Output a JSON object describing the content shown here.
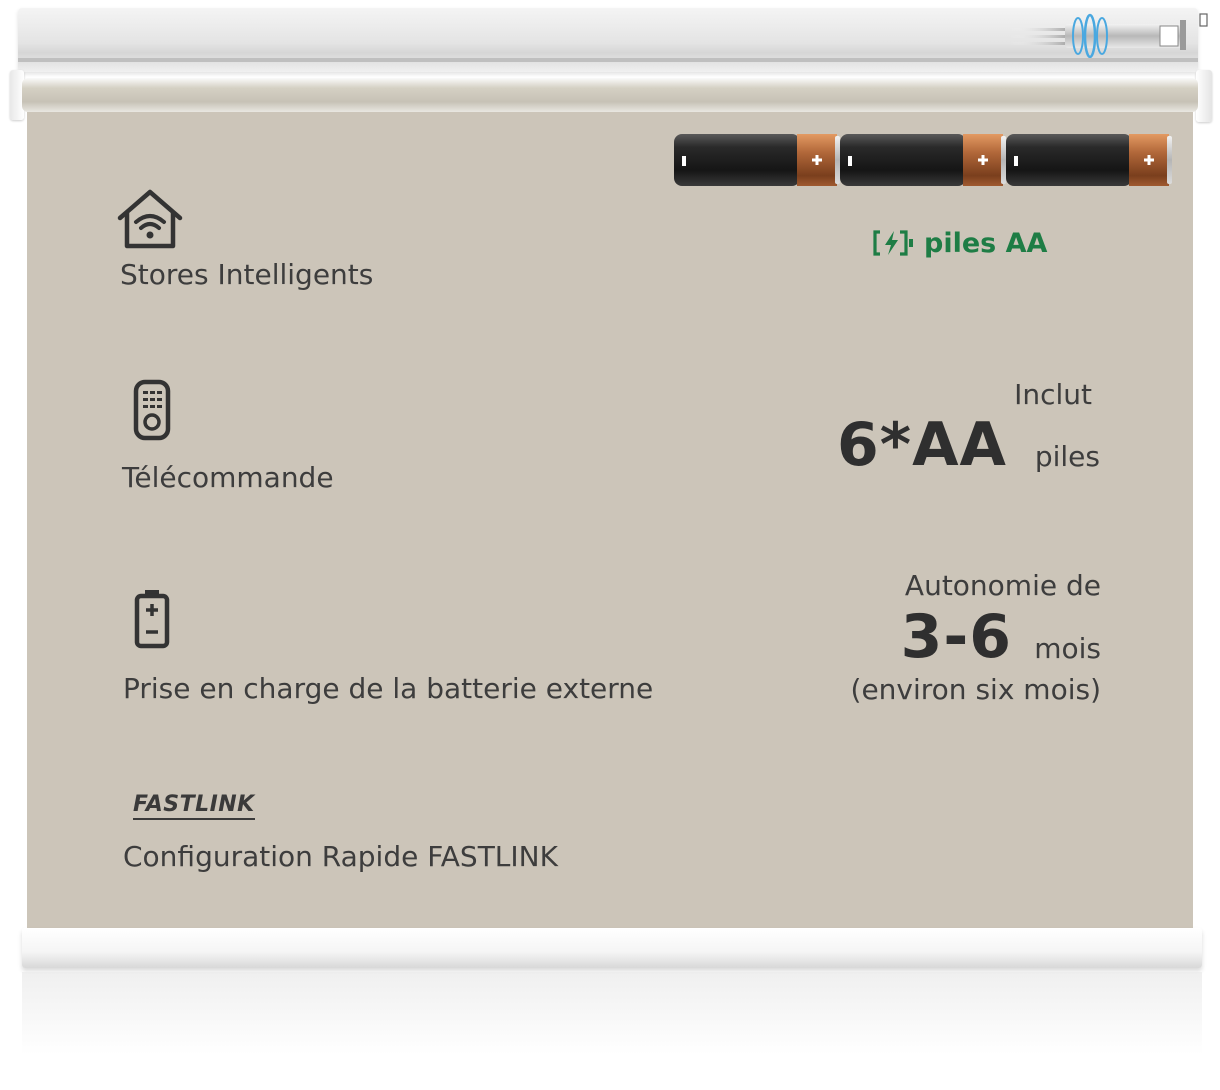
{
  "features": {
    "smart": {
      "label": "Stores Intelligents",
      "icon": "smart-home-wifi-icon"
    },
    "remote": {
      "label": "Télécommande",
      "icon": "remote-control-icon"
    },
    "battery": {
      "label": "Prise en charge de la batterie externe",
      "icon": "battery-icon"
    },
    "fastlink": {
      "logo": "FASTLINK",
      "label": "Configuration Rapide FASTLINK"
    }
  },
  "power": {
    "badge_label": "piles AA",
    "badge_icon": "battery-charging-icon",
    "illustration": "three-aa-batteries"
  },
  "included": {
    "intro": "Inclut",
    "amount": "6*AA",
    "unit": "piles"
  },
  "autonomy": {
    "intro": "Autonomie de",
    "amount": "3-6",
    "unit": "mois",
    "note": "(environ six mois)"
  },
  "colors": {
    "fabric": "#ccc5b9",
    "text": "#3d3d3d",
    "accent_green": "#1e7d45",
    "battery_body": "#1f1f1f",
    "battery_cap": "#b2683a"
  }
}
